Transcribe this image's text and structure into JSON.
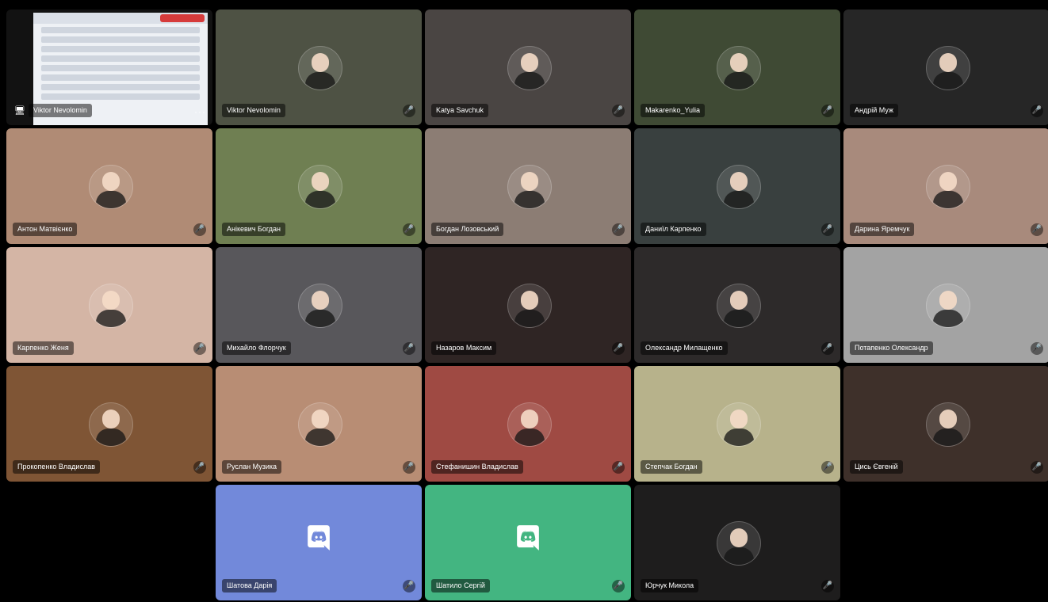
{
  "participants": [
    {
      "name": "Viktor Nevolomin",
      "bg": "#121212",
      "type": "screen"
    },
    {
      "name": "Viktor Nevolomin",
      "bg": "#4e5244",
      "type": "avatar"
    },
    {
      "name": "Katya Savchuk",
      "bg": "#4a4543",
      "type": "avatar"
    },
    {
      "name": "Makarenko_Yulia",
      "bg": "#3f4a34",
      "type": "avatar"
    },
    {
      "name": "Андрій Муж",
      "bg": "#262626",
      "type": "avatar"
    },
    {
      "name": "Антон Матвієнко",
      "bg": "#b08b75",
      "type": "avatar"
    },
    {
      "name": "Анікевич Богдан",
      "bg": "#6f7f52",
      "type": "avatar"
    },
    {
      "name": "Богдан Лозовський",
      "bg": "#8c7d74",
      "type": "avatar"
    },
    {
      "name": "Даниїл Карпенко",
      "bg": "#39403f",
      "type": "avatar"
    },
    {
      "name": "Дарина Яремчук",
      "bg": "#a88a7c",
      "type": "avatar"
    },
    {
      "name": "Карпенко Женя",
      "bg": "#d4b5a5",
      "type": "avatar"
    },
    {
      "name": "Михайло Флорчук",
      "bg": "#58575b",
      "type": "avatar"
    },
    {
      "name": "Назаров Максим",
      "bg": "#2f2524",
      "type": "avatar"
    },
    {
      "name": "Олександр Милащенко",
      "bg": "#2d2a2a",
      "type": "avatar"
    },
    {
      "name": "Потапенко Олександр",
      "bg": "#a3a3a3",
      "type": "avatar"
    },
    {
      "name": "Прокопенко Владислав",
      "bg": "#7f5535",
      "type": "avatar"
    },
    {
      "name": "Руслан Музика",
      "bg": "#b88d74",
      "type": "avatar"
    },
    {
      "name": "Стефанишин Владислав",
      "bg": "#9f4a43",
      "type": "avatar"
    },
    {
      "name": "Степчак Богдан",
      "bg": "#b7b28b",
      "type": "avatar"
    },
    {
      "name": "Цись Євгеній",
      "bg": "#3e302a",
      "type": "avatar"
    },
    {
      "name": "Шатова Дарія",
      "bg": "#7289da",
      "type": "discord"
    },
    {
      "name": "Шатило Сергій",
      "bg": "#43b581",
      "type": "discord"
    },
    {
      "name": "Юрчук Микола",
      "bg": "#1e1d1d",
      "type": "avatar"
    }
  ],
  "icons": {
    "mic": "mic-muted-icon",
    "screen": "monitor-icon",
    "more": "more-options-icon",
    "discord": "discord-logo-icon"
  },
  "text": {
    "more_dots": "···",
    "screen_icon": "🖥"
  }
}
